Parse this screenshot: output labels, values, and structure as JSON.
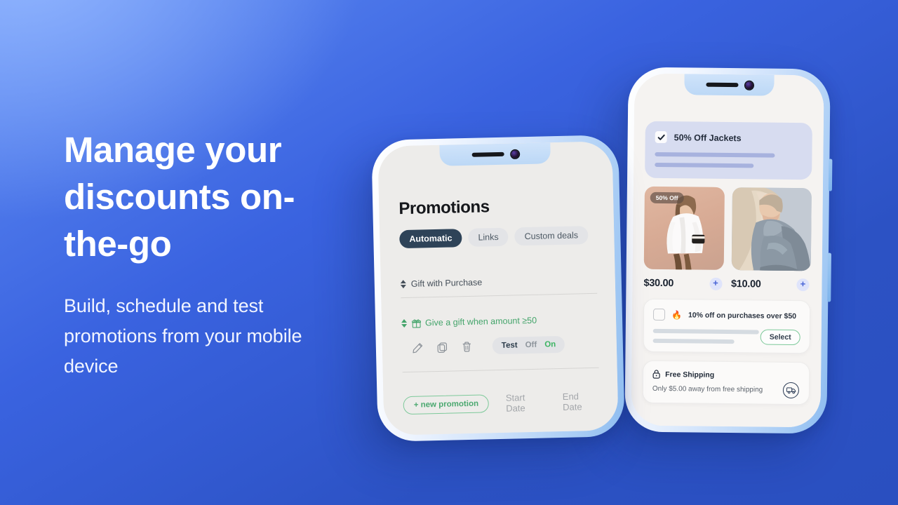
{
  "hero": {
    "headline": "Manage your discounts on-the-go",
    "subhead": "Build, schedule and test promotions from your mobile device"
  },
  "colors": {
    "bg_top_left": "#5e8bf3",
    "bg_bottom_right": "#2c52c4",
    "accent_green": "#43a46a",
    "accent_navy": "#2e4358",
    "plus_blue": "#4763d6"
  },
  "phone_left": {
    "screen_title": "Promotions",
    "tabs": [
      {
        "label": "Automatic",
        "active": true
      },
      {
        "label": "Links",
        "active": false
      },
      {
        "label": "Custom deals",
        "active": false
      }
    ],
    "rows": [
      {
        "label": "Gift with Purchase",
        "highlight": false
      },
      {
        "label": "Give a gift when amount ≥50",
        "highlight": true
      }
    ],
    "action_icons": [
      "pencil-icon",
      "duplicate-icon",
      "trash-icon"
    ],
    "segmented": {
      "test_label": "Test",
      "off_label": "Off",
      "on_label": "On",
      "selected": "On"
    },
    "footer": {
      "new_promotion_label": "+ new promotion",
      "start_date_label": "Start Date",
      "end_date_label": "End Date"
    }
  },
  "phone_right": {
    "jacket_card": {
      "title": "50% Off Jackets",
      "checked": true
    },
    "products": [
      {
        "badge": "50% Off",
        "price": "$30.00",
        "add_label": "+"
      },
      {
        "badge": "",
        "price": "$10.00",
        "add_label": "+"
      }
    ],
    "offer_card": {
      "title": "10% off on purchases over $50",
      "checked": false,
      "icon": "flame-icon",
      "select_label": "Select"
    },
    "shipping_card": {
      "title": "Free Shipping",
      "subtitle": "Only $5.00 away from free shipping",
      "lock_icon": "lock-icon",
      "truck_icon": "delivery-truck-icon"
    }
  }
}
